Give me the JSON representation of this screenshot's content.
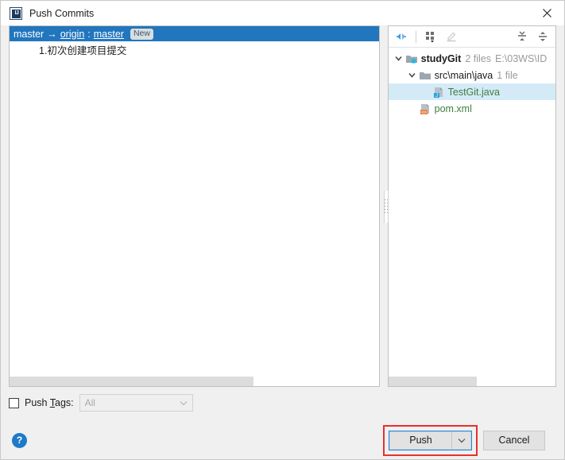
{
  "window": {
    "title": "Push Commits",
    "app_icon": "intellij-idea-icon",
    "close_icon": "close-icon"
  },
  "commits_panel": {
    "repo_row": {
      "source_branch": "master",
      "arrow": "→",
      "remote": "origin",
      "separator": ":",
      "target_branch": "master",
      "badge": "New"
    },
    "commits": [
      {
        "text": "1.初次创建项目提交"
      }
    ],
    "scrollbar": {
      "thumb_percent": 66
    }
  },
  "files_panel": {
    "toolbar": [
      {
        "name": "expand-selection-icon",
        "label": "Expand Selection",
        "enabled": true
      },
      {
        "name": "group-by-icon",
        "label": "Group By",
        "enabled": true
      },
      {
        "name": "edit-source-icon",
        "label": "Edit Source",
        "enabled": false
      },
      {
        "name": "expand-all-icon",
        "label": "Expand All",
        "enabled": true
      },
      {
        "name": "collapse-all-icon",
        "label": "Collapse All",
        "enabled": true
      }
    ],
    "tree": [
      {
        "name": "studyGit",
        "meta": "2 files",
        "path": "E:\\03WS\\ID",
        "icon": "module-folder-icon",
        "depth": 0,
        "expanded": true,
        "bold": true,
        "green": false,
        "selected": false
      },
      {
        "name": "src\\main\\java",
        "meta": "1 file",
        "path": "",
        "icon": "folder-icon",
        "depth": 1,
        "expanded": true,
        "bold": false,
        "green": false,
        "selected": false
      },
      {
        "name": "TestGit.java",
        "meta": "",
        "path": "",
        "icon": "java-file-icon",
        "depth": 2,
        "expanded": null,
        "bold": false,
        "green": true,
        "selected": true
      },
      {
        "name": "pom.xml",
        "meta": "",
        "path": "",
        "icon": "xml-file-icon",
        "depth": 1,
        "expanded": null,
        "bold": false,
        "green": true,
        "selected": false
      }
    ],
    "scrollbar": {
      "thumb_percent": 53
    }
  },
  "push_tags": {
    "checked": false,
    "label_before": "Push ",
    "label_mnemonic": "T",
    "label_after": "ags:",
    "select_value": "All",
    "enabled": false
  },
  "footer": {
    "help_label": "?",
    "push_label": "Push",
    "push_dropdown_icon": "chevron-down-icon",
    "cancel_label": "Cancel",
    "highlight_color": "#e8312b",
    "focus_color": "#1e88e5"
  }
}
